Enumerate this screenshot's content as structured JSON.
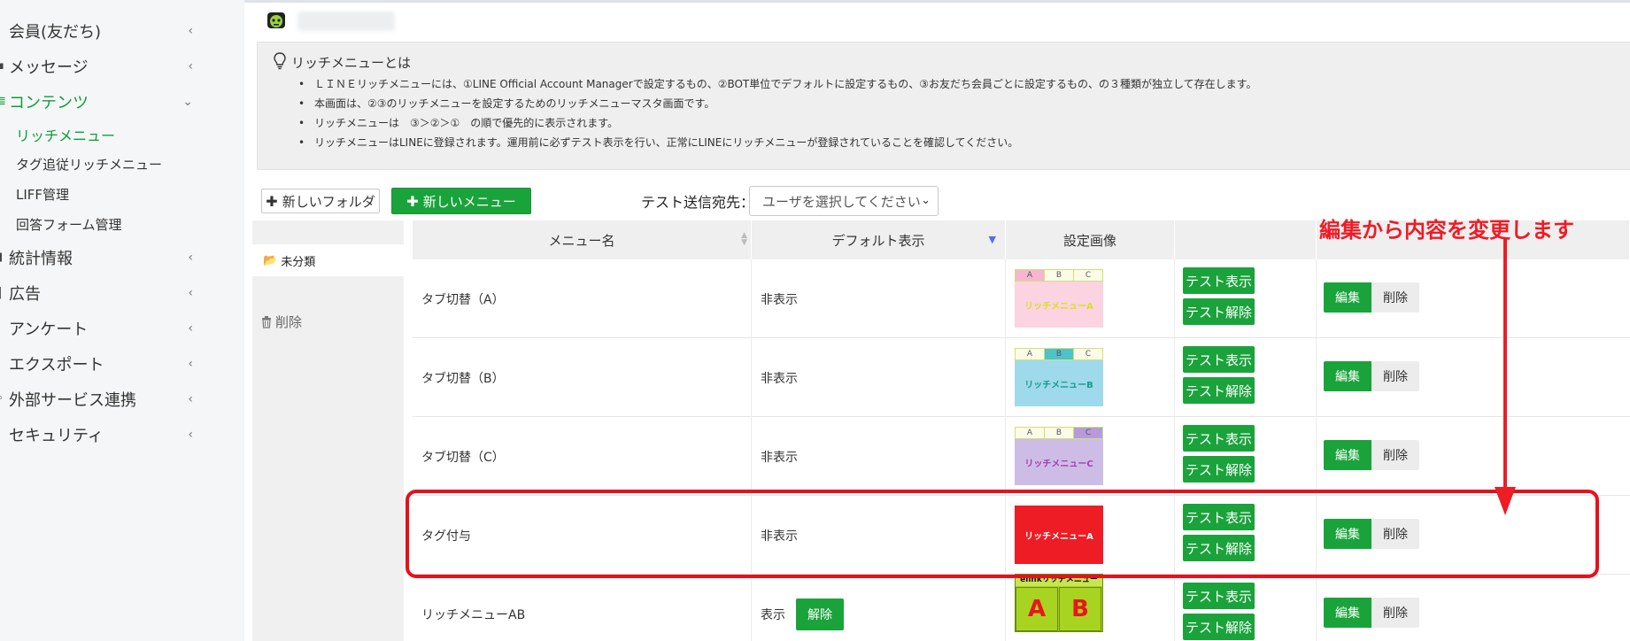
{
  "sidebar": {
    "items": [
      {
        "label": "会員(友だち)",
        "chevron": "‹",
        "active": false
      },
      {
        "label": "メッセージ",
        "chevron": "‹",
        "active": false
      },
      {
        "label": "コンテンツ",
        "chevron": "⌄",
        "active": true
      },
      {
        "label": "統計情報",
        "chevron": "‹",
        "active": false
      },
      {
        "label": "広告",
        "chevron": "‹",
        "active": false
      },
      {
        "label": "アンケート",
        "chevron": "‹",
        "active": false
      },
      {
        "label": "エクスポート",
        "chevron": "‹",
        "active": false
      },
      {
        "label": "外部サービス連携",
        "chevron": "‹",
        "active": false
      },
      {
        "label": "セキュリティ",
        "chevron": "‹",
        "active": false
      }
    ],
    "subitems": [
      {
        "label": "リッチメニュー",
        "active": true
      },
      {
        "label": "タグ追従リッチメニュー",
        "active": false
      },
      {
        "label": "LIFF管理",
        "active": false
      },
      {
        "label": "回答フォーム管理",
        "active": false
      }
    ]
  },
  "info": {
    "title": "リッチメニューとは",
    "lines": [
      "ＬＩＮＥリッチメニューには、①LINE Official Account Managerで設定するもの、②BOT単位でデフォルトに設定するもの、③お友だち会員ごとに設定するもの、の３種類が独立して存在します。",
      "本画面は、②③のリッチメニューを設定するためのリッチメニューマスタ画面です。",
      "リッチメニューは　③＞②＞①　の順で優先的に表示されます。",
      "リッチメニューはLINEに登録されます。運用前に必ずテスト表示を行い、正常にLINEにリッチメニューが登録されていることを確認してください。"
    ]
  },
  "toolbar": {
    "new_folder": "新しいフォルダ",
    "new_menu": "新しいメニュー",
    "test_label": "テスト送信宛先：",
    "user_select_placeholder": "ユーザを選択してください"
  },
  "folders": {
    "active": "未分類",
    "delete": "削除"
  },
  "table": {
    "headers": [
      "メニュー名",
      "デフォルト表示",
      "設定画像",
      "",
      ""
    ],
    "rows": [
      {
        "name": "タブ切替（A）",
        "default": "非表示",
        "thumb": {
          "kind": "tabs",
          "tabs": [
            "A",
            "B",
            "C"
          ],
          "active_tab": 0,
          "body": "リッチメニューA",
          "body_color": "#fbd3e1",
          "text_color": "#d8e21a",
          "active_color": "#f6b6cf"
        },
        "release": null
      },
      {
        "name": "タブ切替（B）",
        "default": "非表示",
        "thumb": {
          "kind": "tabs",
          "tabs": [
            "A",
            "B",
            "C"
          ],
          "active_tab": 1,
          "body": "リッチメニューB",
          "body_color": "#9fd9ec",
          "text_color": "#1a9a8a",
          "active_color": "#4fc2c8"
        },
        "release": null
      },
      {
        "name": "タブ切替（C）",
        "default": "非表示",
        "thumb": {
          "kind": "tabs",
          "tabs": [
            "A",
            "B",
            "C"
          ],
          "active_tab": 2,
          "body": "リッチメニューC",
          "body_color": "#cdbde6",
          "text_color": "#a23fb1",
          "active_color": "#b79ad8"
        },
        "release": null
      },
      {
        "name": "タグ付与",
        "default": "非表示",
        "thumb": {
          "kind": "red",
          "body": "リッチメニューA"
        },
        "release": null
      },
      {
        "name": "リッチメニューAB",
        "default": "表示",
        "thumb": {
          "kind": "ab",
          "title": "elinkリッチメニュー",
          "cells": [
            "A",
            "B"
          ]
        },
        "release": "解除"
      }
    ],
    "test_show": "テスト表示",
    "test_release": "テスト解除",
    "edit": "編集",
    "delete": "削除"
  },
  "annotation": {
    "text": "編集から内容を変更します",
    "color": "#ee1c25"
  },
  "colors": {
    "accent_green": "#1aa33b",
    "nav_active": "#0d9e38",
    "annotation_red": "#ee1c25"
  }
}
